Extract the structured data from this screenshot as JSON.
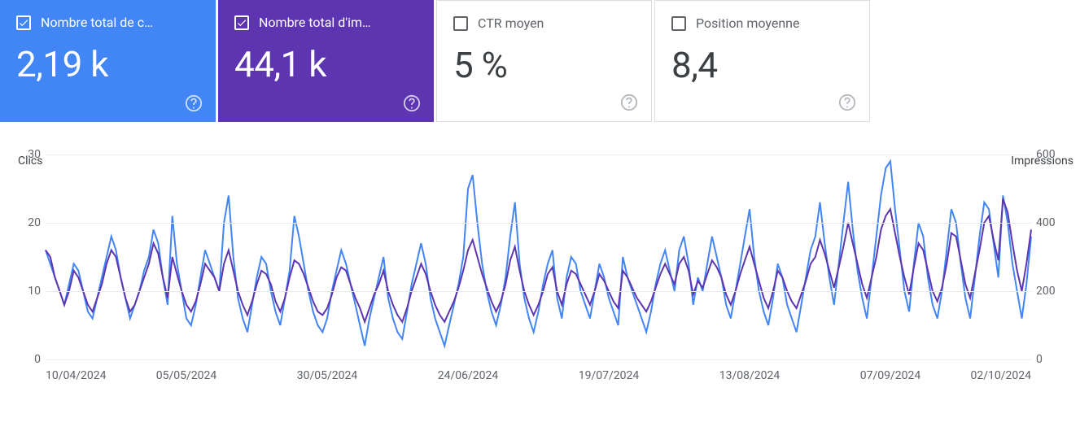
{
  "cards": [
    {
      "id": "clicks-card",
      "label": "Nombre total de c…",
      "value": "2,19 k",
      "checked": true,
      "style": "clicks"
    },
    {
      "id": "impr-card",
      "label": "Nombre total d'im…",
      "value": "44,1 k",
      "checked": true,
      "style": "impr"
    },
    {
      "id": "ctr-card",
      "label": "CTR moyen",
      "value": "5 %",
      "checked": false,
      "style": "ctr"
    },
    {
      "id": "pos-card",
      "label": "Position moyenne",
      "value": "8,4",
      "checked": false,
      "style": "pos"
    }
  ],
  "chart": {
    "left_axis_label": "Clics",
    "right_axis_label": "Impressions",
    "left_ticks": [
      "0",
      "10",
      "20",
      "30"
    ],
    "right_ticks": [
      "0",
      "200",
      "400",
      "600"
    ],
    "x_ticks": [
      "10/04/2024",
      "05/05/2024",
      "30/05/2024",
      "24/06/2024",
      "19/07/2024",
      "13/08/2024",
      "07/09/2024",
      "02/10/2024"
    ]
  },
  "chart_data": {
    "type": "line",
    "xlabel": "",
    "title": "",
    "series": [
      {
        "name": "Clics",
        "axis": "left",
        "color": "#4285f4",
        "ylim": [
          0,
          30
        ],
        "values": [
          16,
          14,
          12,
          10,
          8,
          11,
          14,
          13,
          10,
          7,
          6,
          9,
          12,
          15,
          18,
          16,
          12,
          9,
          6,
          8,
          10,
          13,
          15,
          19,
          17,
          12,
          8,
          21,
          14,
          10,
          6,
          5,
          8,
          12,
          16,
          14,
          12,
          10,
          20,
          24,
          15,
          9,
          6,
          4,
          8,
          12,
          15,
          14,
          10,
          7,
          5,
          9,
          13,
          21,
          18,
          14,
          10,
          7,
          5,
          4,
          6,
          10,
          13,
          16,
          14,
          11,
          8,
          5,
          2,
          6,
          9,
          12,
          15,
          9,
          6,
          4,
          3,
          7,
          11,
          14,
          17,
          14,
          9,
          6,
          4,
          2,
          5,
          8,
          11,
          15,
          25,
          27,
          20,
          14,
          10,
          7,
          5,
          8,
          12,
          18,
          23,
          14,
          9,
          6,
          4,
          7,
          11,
          14,
          16,
          9,
          6,
          12,
          15,
          14,
          10,
          8,
          6,
          10,
          14,
          12,
          9,
          7,
          5,
          15,
          12,
          10,
          8,
          6,
          4,
          7,
          11,
          14,
          16,
          13,
          10,
          16,
          18,
          14,
          8,
          12,
          10,
          14,
          18,
          15,
          12,
          8,
          6,
          10,
          14,
          18,
          22,
          15,
          10,
          7,
          5,
          9,
          14,
          12,
          8,
          6,
          4,
          8,
          12,
          16,
          18,
          23,
          17,
          12,
          8,
          14,
          20,
          26,
          19,
          13,
          9,
          6,
          12,
          18,
          24,
          28,
          29,
          22,
          16,
          10,
          7,
          14,
          20,
          18,
          12,
          8,
          6,
          10,
          16,
          22,
          20,
          14,
          9,
          6,
          12,
          18,
          23,
          22,
          17,
          12,
          24,
          20,
          14,
          10,
          6,
          11,
          18
        ]
      },
      {
        "name": "Impressions",
        "axis": "right",
        "color": "#5e35b1",
        "ylim": [
          0,
          600
        ],
        "values": [
          320,
          300,
          240,
          200,
          160,
          200,
          260,
          240,
          200,
          160,
          140,
          180,
          220,
          280,
          320,
          300,
          240,
          180,
          140,
          160,
          200,
          240,
          280,
          340,
          310,
          240,
          180,
          300,
          250,
          200,
          160,
          140,
          170,
          220,
          280,
          260,
          240,
          200,
          280,
          320,
          260,
          200,
          160,
          130,
          170,
          220,
          260,
          250,
          220,
          170,
          140,
          180,
          240,
          290,
          280,
          250,
          210,
          170,
          140,
          130,
          150,
          190,
          240,
          270,
          260,
          220,
          180,
          150,
          110,
          150,
          190,
          220,
          260,
          200,
          160,
          130,
          110,
          150,
          200,
          240,
          280,
          250,
          200,
          160,
          130,
          110,
          140,
          170,
          210,
          260,
          320,
          350,
          300,
          250,
          210,
          170,
          140,
          170,
          220,
          290,
          330,
          260,
          200,
          160,
          130,
          160,
          200,
          250,
          270,
          200,
          160,
          220,
          260,
          250,
          220,
          190,
          160,
          200,
          250,
          230,
          200,
          170,
          150,
          260,
          240,
          210,
          180,
          160,
          140,
          170,
          210,
          250,
          280,
          250,
          220,
          280,
          300,
          260,
          190,
          230,
          210,
          250,
          290,
          270,
          240,
          190,
          160,
          200,
          250,
          290,
          330,
          280,
          230,
          180,
          150,
          200,
          260,
          240,
          200,
          170,
          150,
          190,
          230,
          280,
          300,
          350,
          310,
          260,
          210,
          270,
          330,
          400,
          340,
          280,
          220,
          180,
          240,
          300,
          380,
          420,
          440,
          370,
          300,
          240,
          190,
          270,
          340,
          320,
          260,
          200,
          170,
          210,
          280,
          370,
          360,
          290,
          220,
          180,
          250,
          320,
          400,
          420,
          350,
          290,
          470,
          430,
          340,
          260,
          200,
          280,
          380
        ]
      }
    ],
    "x_tick_labels": [
      "10/04/2024",
      "05/05/2024",
      "30/05/2024",
      "24/06/2024",
      "19/07/2024",
      "13/08/2024",
      "07/09/2024",
      "02/10/2024"
    ]
  }
}
